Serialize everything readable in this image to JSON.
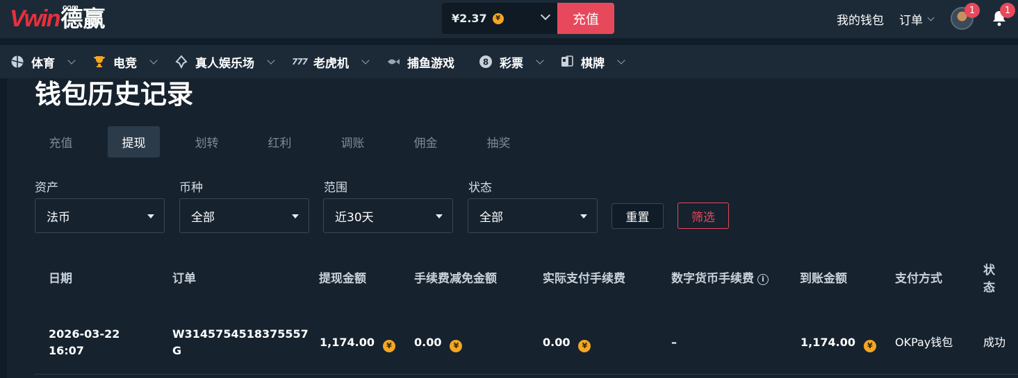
{
  "header": {
    "logo_brand": "Vwin",
    "logo_com": "com",
    "logo_cn": "德赢",
    "balance": "¥2.37",
    "coin_symbol": "¥",
    "deposit_label": "充值",
    "wallet_label": "我的钱包",
    "orders_label": "订单",
    "avatar_badge": "1",
    "bell_badge": "1"
  },
  "nav": {
    "items": [
      {
        "label": "体育",
        "icon": "sports-ball-icon"
      },
      {
        "label": "电竞",
        "icon": "trophy-icon"
      },
      {
        "label": "真人娱乐场",
        "icon": "spade-icon"
      },
      {
        "label": "老虎机",
        "icon": "slot-777-icon"
      },
      {
        "label": "捕鱼游戏",
        "icon": "fish-icon"
      },
      {
        "label": "彩票",
        "icon": "lottery-ball-icon"
      },
      {
        "label": "棋牌",
        "icon": "cards-icon"
      }
    ]
  },
  "page": {
    "title": "钱包历史记录",
    "tabs": [
      "充值",
      "提现",
      "划转",
      "红利",
      "调账",
      "佣金",
      "抽奖"
    ],
    "active_tab": "提现"
  },
  "filters": {
    "asset_label": "资产",
    "asset_value": "法币",
    "currency_label": "币种",
    "currency_value": "全部",
    "range_label": "范围",
    "range_value": "近30天",
    "status_label": "状态",
    "status_value": "全部",
    "reset_label": "重置",
    "filter_label": "筛选"
  },
  "table": {
    "headers": [
      "日期",
      "订单",
      "提现金额",
      "手续费减免金额",
      "实际支付手续费",
      "数字货币手续费",
      "到账金额",
      "支付方式",
      "状态"
    ],
    "rows": [
      {
        "date": "2026-03-22",
        "time": "16:07",
        "order_line1": "W3145754518375557",
        "order_line2": "G",
        "amount": "1,174.00",
        "fee_waived": "0.00",
        "fee_paid": "0.00",
        "crypto_fee": "–",
        "received": "1,174.00",
        "method": "OKPay钱包",
        "status": "成功"
      }
    ]
  }
}
